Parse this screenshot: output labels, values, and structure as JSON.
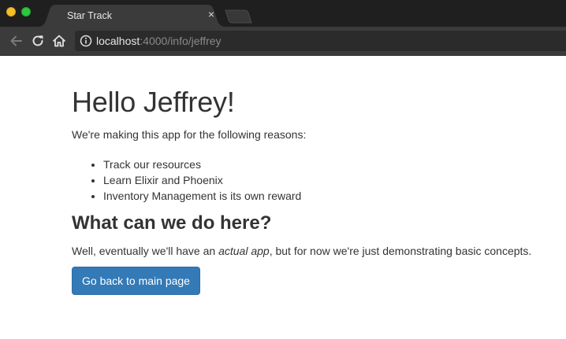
{
  "browser": {
    "tab": {
      "title": "Star Track",
      "close_glyph": "×"
    },
    "address": {
      "host": "localhost",
      "rest": ":4000/info/jeffrey"
    },
    "icons": {
      "back": "arrow-left-icon",
      "reload": "reload-icon",
      "home": "home-icon",
      "info": "info-icon",
      "close": "close-icon"
    },
    "colors": {
      "tabstrip": "#1f1f1f",
      "toolbar": "#3b3b3b",
      "traffic_yellow": "#f5bf2a",
      "traffic_green": "#2bc840"
    }
  },
  "page": {
    "heading": "Hello Jeffrey!",
    "intro": "We're making this app for the following reasons:",
    "reasons": [
      "Track our resources",
      "Learn Elixir and Phoenix",
      "Inventory Management is its own reward"
    ],
    "subheading": "What can we do here?",
    "explain": {
      "before": "Well, eventually we'll have an ",
      "emphasis": "actual app",
      "after": ", but for now we're just demonstrating basic concepts."
    },
    "back_button": "Go back to main page",
    "colors": {
      "text": "#333333",
      "button_bg": "#337ab7",
      "button_text": "#ffffff"
    }
  }
}
